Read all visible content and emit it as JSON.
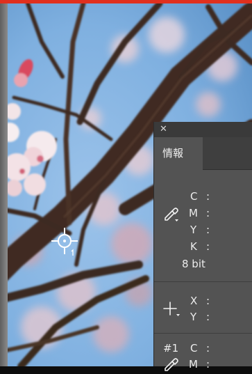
{
  "window": {
    "accent_bar_color": "#e0301e"
  },
  "panel": {
    "tab_label": "情報",
    "close_icon_name": "close-icon",
    "color_readout": {
      "icon": "eyedropper-icon",
      "rows": [
        {
          "label": "C",
          "colon": ":"
        },
        {
          "label": "M",
          "colon": ":"
        },
        {
          "label": "Y",
          "colon": ":"
        },
        {
          "label": "K",
          "colon": ":"
        }
      ],
      "bit_depth": "8 bit"
    },
    "position_readout": {
      "icon": "crosshair-plus-icon",
      "rows": [
        {
          "label": "X",
          "colon": ":"
        },
        {
          "label": "Y",
          "colon": ":"
        }
      ]
    },
    "sampler_1": {
      "tag": "#1",
      "icon": "eyedropper-icon",
      "rows": [
        {
          "label": "C",
          "colon": ":"
        },
        {
          "label": "M",
          "colon": ":"
        }
      ]
    }
  },
  "canvas": {
    "cursor_icon": "target-crosshair-icon"
  }
}
